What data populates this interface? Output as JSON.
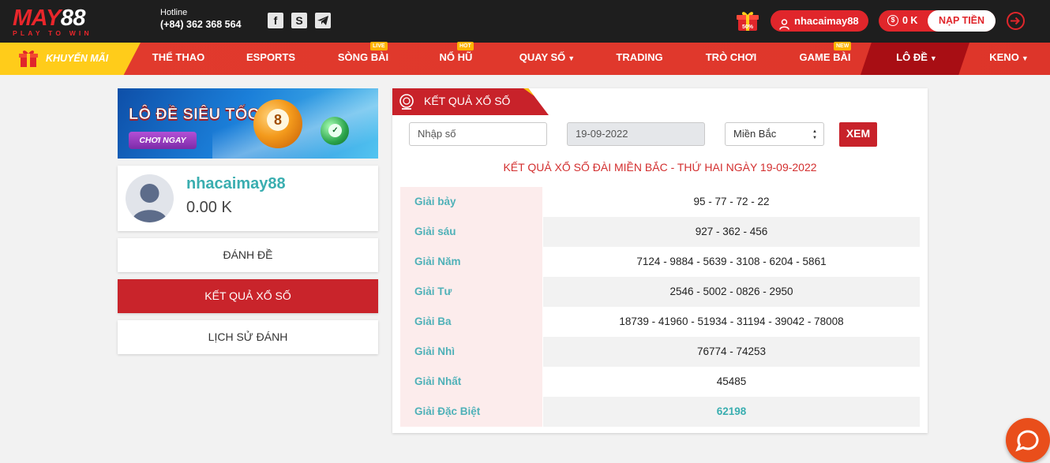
{
  "brand": {
    "logo_prefix": "MAY",
    "logo_suffix": "88",
    "tagline": "PLAY TO WIN"
  },
  "header": {
    "hotline_label": "Hotline",
    "hotline_number": "(+84) 362 368 564",
    "social_icons": [
      "facebook-icon",
      "skype-icon",
      "telegram-icon"
    ],
    "username": "nhacaimay88",
    "balance": "0 K",
    "deposit_label": "NẠP TIỀN"
  },
  "nav": {
    "promo_label": "KHUYẾN MÃI",
    "items": [
      {
        "label": "THỂ THAO"
      },
      {
        "label": "ESPORTS"
      },
      {
        "label": "SÒNG BÀI",
        "badge": "LIVE"
      },
      {
        "label": "NỔ HŨ",
        "badge": "HOT"
      },
      {
        "label": "QUAY SỐ",
        "caret": "⌄"
      },
      {
        "label": "TRADING"
      },
      {
        "label": "TRÒ CHƠI"
      },
      {
        "label": "GAME BÀI",
        "badge": "NEW"
      },
      {
        "label": "LÔ ĐỀ",
        "caret": "⌄"
      },
      {
        "label": "KENO",
        "caret": "⌄"
      }
    ]
  },
  "banner": {
    "title": "LÔ ĐỀ SIÊU TỐC",
    "button": "CHƠI NGAY",
    "ball_number": "8"
  },
  "profile": {
    "username": "nhacaimay88",
    "balance": "0.00 K"
  },
  "side_menu": [
    {
      "label": "ĐÁNH ĐỀ",
      "active": false
    },
    {
      "label": "KẾT QUẢ XỔ SỐ",
      "active": true
    },
    {
      "label": "LỊCH SỬ ĐÁNH",
      "active": false
    }
  ],
  "panel": {
    "tab_title": "KẾT QUẢ XỔ SỐ",
    "number_placeholder": "Nhập số",
    "date_value": "19-09-2022",
    "region_value": "Miền Bắc",
    "submit_label": "XEM",
    "result_title": "KẾT QUẢ XỔ SỐ ĐÀI MIỀN BẮC - THỨ HAI NGÀY 19-09-2022",
    "results": [
      {
        "name": "Giải bảy",
        "value": "95 - 77 - 72 - 22"
      },
      {
        "name": "Giải sáu",
        "value": "927 - 362 - 456"
      },
      {
        "name": "Giải Năm",
        "value": "7124 - 9884 - 5639 - 3108 - 6204 - 5861"
      },
      {
        "name": "Giải Tư",
        "value": "2546 - 5002 - 0826 - 2950"
      },
      {
        "name": "Giải Ba",
        "value": "18739 - 41960 - 51934 - 31194 - 39042 - 78008"
      },
      {
        "name": "Giải Nhì",
        "value": "76774 - 74253"
      },
      {
        "name": "Giải Nhất",
        "value": "45485"
      },
      {
        "name": "Giải Đặc Biệt",
        "value": "62198"
      }
    ]
  },
  "colors": {
    "brand_red": "#e0262b",
    "accent_teal": "#3aaeb0",
    "promo_yellow": "#ffcc1a"
  }
}
